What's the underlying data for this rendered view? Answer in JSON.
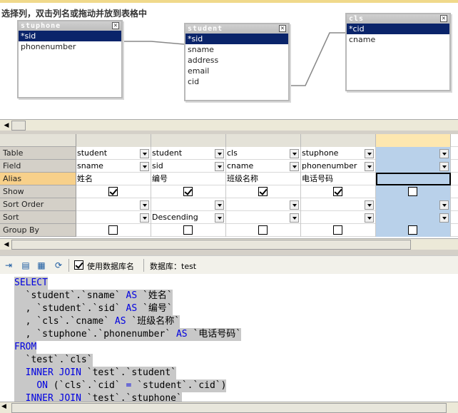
{
  "hint": "选择列，双击列名或拖动并放到表格中",
  "tables": [
    {
      "name": "stuphone",
      "fields": [
        "*sid",
        "phonenumber"
      ],
      "selected": 0
    },
    {
      "name": "student",
      "fields": [
        "*sid",
        "sname",
        "address",
        "email",
        "cid"
      ],
      "selected": 0
    },
    {
      "name": "cls",
      "fields": [
        "*cid",
        "cname"
      ],
      "selected": 0
    }
  ],
  "grid": {
    "row_labels": [
      "Table",
      "Field",
      "Alias",
      "Show",
      "Sort Order",
      "Sort",
      "Group By"
    ],
    "columns": [
      {
        "table": "student",
        "field": "sname",
        "alias": "姓名",
        "show": true,
        "sort_order": "",
        "sort": "",
        "group_by": false
      },
      {
        "table": "student",
        "field": "sid",
        "alias": "编号",
        "show": true,
        "sort_order": "",
        "sort": "Descending",
        "group_by": false
      },
      {
        "table": "cls",
        "field": "cname",
        "alias": "班级名称",
        "show": true,
        "sort_order": "",
        "sort": "",
        "group_by": false
      },
      {
        "table": "stuphone",
        "field": "phonenumber",
        "alias": "电话号码",
        "show": true,
        "sort_order": "",
        "sort": "",
        "group_by": false
      },
      {
        "table": "",
        "field": "",
        "alias": "",
        "show": false,
        "sort_order": "",
        "sort": "",
        "group_by": false
      }
    ]
  },
  "toolbar": {
    "use_db_name_label": "使用数据库名",
    "use_db_name_checked": true,
    "database_label": "数据库：test"
  },
  "sql_lines": [
    {
      "parts": [
        [
          "kw",
          "SELECT"
        ]
      ]
    },
    {
      "parts": [
        [
          "t",
          "  `student`.`sname` "
        ],
        [
          "kw",
          "AS"
        ],
        [
          "t",
          " `姓名`"
        ]
      ]
    },
    {
      "parts": [
        [
          "t",
          "  , `student`.`sid` "
        ],
        [
          "kw",
          "AS"
        ],
        [
          "t",
          " `编号`"
        ]
      ]
    },
    {
      "parts": [
        [
          "t",
          "  , `cls`.`cname` "
        ],
        [
          "kw",
          "AS"
        ],
        [
          "t",
          " `班级名称`"
        ]
      ]
    },
    {
      "parts": [
        [
          "t",
          "  , `stuphone`.`phonenumber` "
        ],
        [
          "kw",
          "AS"
        ],
        [
          "t",
          " `电话号码`"
        ]
      ]
    },
    {
      "parts": [
        [
          "kw",
          "FROM"
        ]
      ]
    },
    {
      "parts": [
        [
          "t",
          "  `test`.`cls`"
        ]
      ]
    },
    {
      "parts": [
        [
          "t",
          "  "
        ],
        [
          "kw",
          "INNER JOIN"
        ],
        [
          "t",
          " `test`.`student`"
        ]
      ]
    },
    {
      "parts": [
        [
          "t",
          "    "
        ],
        [
          "kw",
          "ON"
        ],
        [
          "t",
          " (`cls`.`cid` "
        ],
        [
          "kw",
          "="
        ],
        [
          "t",
          " `student`.`cid`)"
        ]
      ]
    },
    {
      "parts": [
        [
          "t",
          "  "
        ],
        [
          "kw",
          "INNER JOIN"
        ],
        [
          "t",
          " `test`.`stuphone`"
        ]
      ]
    }
  ],
  "colors": {
    "accent": "#0a246a",
    "keyword": "#0000e0",
    "selected_col": "#b9d1ea",
    "alias_label": "#f7d08a"
  }
}
